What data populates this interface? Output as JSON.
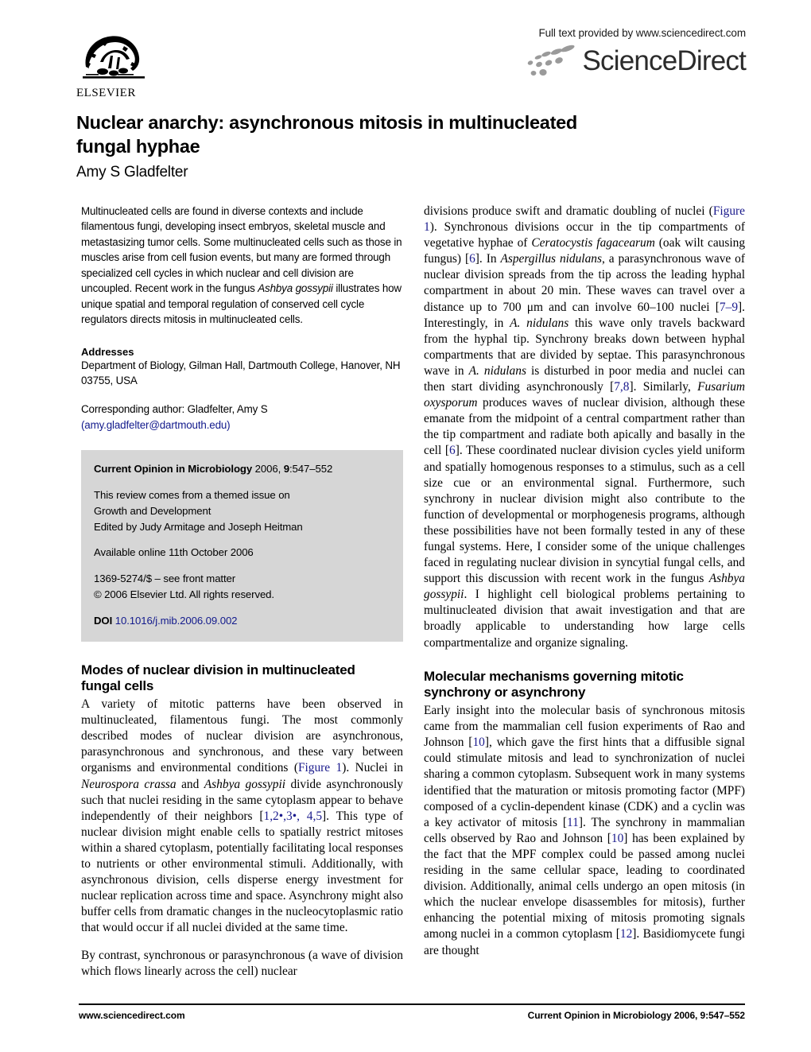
{
  "header": {
    "publisher_logo_text": "ELSEVIER",
    "full_text_notice": "Full text provided by www.sciencedirect.com",
    "sciencedirect_wordmark": "ScienceDirect"
  },
  "title": {
    "line1": "Nuclear anarchy: asynchronous mitosis in multinucleated",
    "line2": "fungal hyphae",
    "author": "Amy S Gladfelter"
  },
  "abstract": {
    "text_part1": "Multinucleated cells are found in diverse contexts and include filamentous fungi, developing insect embryos, skeletal muscle and metastasizing tumor cells. Some multinucleated cells such as those in muscles arise from cell fusion events, but many are formed through specialized cell cycles in which nuclear and cell division are uncoupled. Recent work in the fungus ",
    "italic1": "Ashbya gossypii",
    "text_part2": " illustrates how unique spatial and temporal regulation of conserved cell cycle regulators directs mitosis in multinucleated cells."
  },
  "front_matter": {
    "addresses_heading": "Addresses",
    "addresses_text": "Department of Biology, Gilman Hall, Dartmouth College, Hanover, NH 03755, USA",
    "corresponding_label": "Corresponding author: Gladfelter, Amy S",
    "corresponding_email": "(amy.gladfelter@dartmouth.edu)"
  },
  "journal_box": {
    "journal_name": "Current Opinion in Microbiology",
    "year_prefix": " 2006, ",
    "volume": "9",
    "pages": ":547–552",
    "themed_line1": "This review comes from a themed issue on",
    "themed_line2": "Growth and Development",
    "themed_line3": "Edited by Judy Armitage and Joseph Heitman",
    "available_online": "Available online 11th October 2006",
    "front_matter_line": "1369-5274/$ – see front matter",
    "copyright_line": "© 2006 Elsevier Ltd. All rights reserved.",
    "doi_label": "DOI",
    "doi_value": "10.1016/j.mib.2006.09.002"
  },
  "sections": {
    "modes_heading_line1": "Modes of nuclear division in multinucleated",
    "modes_heading_line2": "fungal cells",
    "molecular_heading_line1": "Molecular mechanisms governing mitotic",
    "molecular_heading_line2": "synchrony or asynchrony"
  },
  "body": {
    "left_p1_a": "A variety of mitotic patterns have been observed in multinucleated, filamentous fungi. The most commonly described modes of nuclear division are asynchronous, parasynchronous and synchronous, and these vary between organisms and environmental conditions (",
    "left_p1_figref": "Figure 1",
    "left_p1_b": "). Nuclei in ",
    "left_p1_it1": "Neurospora crassa",
    "left_p1_c": " and ",
    "left_p1_it2": "Ashbya gossypii",
    "left_p1_d": " divide asynchronously such that nuclei residing in the same cytoplasm appear to behave independently of their neighbors [",
    "left_p1_ref1": "1,2",
    "left_p1_star1": "•",
    "left_p1_ref2": ",3",
    "left_p1_star2": "•",
    "left_p1_ref3": ", 4,5",
    "left_p1_e": "]. This type of nuclear division might enable cells to spatially restrict mitoses within a shared cytoplasm, potentially facilitating local responses to nutrients or other environmental stimuli. Additionally, with asynchronous division, cells disperse energy investment for nuclear replication across time and space. Asynchrony might also buffer cells from dramatic changes in the nucleocytoplasmic ratio that would occur if all nuclei divided at the same time.",
    "left_p2": "By contrast, synchronous or parasynchronous (a wave of division which flows linearly across the cell) nuclear",
    "right_p1_a": "divisions produce swift and dramatic doubling of nuclei (",
    "right_p1_figref": "Figure 1",
    "right_p1_b": "). Synchronous divisions occur in the tip compartments of vegetative hyphae of ",
    "right_p1_it1": "Ceratocystis fagacearum",
    "right_p1_c": " (oak wilt causing fungus) [",
    "right_p1_ref1": "6",
    "right_p1_d": "]. In ",
    "right_p1_it2": "Aspergillus nidulans",
    "right_p1_e": ", a parasynchronous wave of nuclear division spreads from the tip across the leading hyphal compartment in about 20 min. These waves can travel over a distance up to 700 μm and can involve 60–100 nuclei [",
    "right_p1_ref2": "7–9",
    "right_p1_f": "]. Interestingly, in ",
    "right_p1_it3": "A. nidulans",
    "right_p1_g": " this wave only travels backward from the hyphal tip. Synchrony breaks down between hyphal compartments that are divided by septae. This parasynchronous wave in ",
    "right_p1_it4": "A. nidulans",
    "right_p1_h": " is disturbed in poor media and nuclei can then start dividing asynchronously [",
    "right_p1_ref3": "7,8",
    "right_p1_i": "]. Similarly, ",
    "right_p1_it5": "Fusarium oxysporum",
    "right_p1_j": " produces waves of nuclear division, although these emanate from the midpoint of a central compartment rather than the tip compartment and radiate both apically and basally in the cell [",
    "right_p1_ref4": "6",
    "right_p1_k": "]. These coordinated nuclear division cycles yield uniform and spatially homogenous responses to a stimulus, such as a cell size cue or an environmental signal. Furthermore, such synchrony in nuclear division might also contribute to the function of developmental or morphogenesis programs, although these possibilities have not been formally tested in any of these fungal systems. Here, I consider some of the unique challenges faced in regulating nuclear division in syncytial fungal cells, and support this discussion with recent work in the fungus ",
    "right_p1_it6": "Ashbya gossypii",
    "right_p1_l": ". I highlight cell biological problems pertaining to multinucleated division that await investigation and that are broadly applicable to understanding how large cells compartmentalize and organize signaling.",
    "right_p2_a": "Early insight into the molecular basis of synchronous mitosis came from the mammalian cell fusion experiments of Rao and Johnson [",
    "right_p2_ref1": "10",
    "right_p2_b": "], which gave the first hints that a diffusible signal could stimulate mitosis and lead to synchronization of nuclei sharing a common cytoplasm. Subsequent work in many systems identified that the maturation or mitosis promoting factor (MPF) composed of a cyclin-dependent kinase (CDK) and a cyclin was a key activator of mitosis [",
    "right_p2_ref2": "11",
    "right_p2_c": "]. The synchrony in mammalian cells observed by Rao and Johnson [",
    "right_p2_ref3": "10",
    "right_p2_d": "] has been explained by the fact that the MPF complex could be passed among nuclei residing in the same cellular space, leading to coordinated division. Additionally, animal cells undergo an open mitosis (in which the nuclear envelope disassembles for mitosis), further enhancing the potential mixing of mitosis promoting signals among nuclei in a common cytoplasm [",
    "right_p2_ref4": "12",
    "right_p2_e": "]. Basidiomycete fungi are thought"
  },
  "footer": {
    "left": "www.sciencedirect.com",
    "right_journal": "Current Opinion in Microbiology",
    "right_cite": " 2006, 9:547–552"
  },
  "colors": {
    "link": "#121a8c",
    "reference": "#1a1a8c",
    "journal_box_bg": "#d6d6d6"
  }
}
